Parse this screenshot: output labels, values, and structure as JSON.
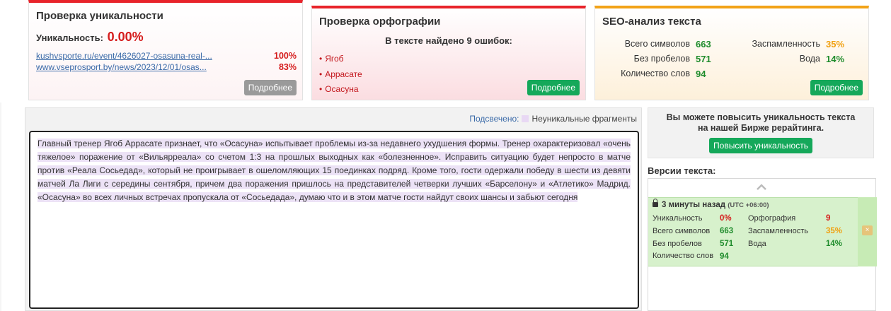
{
  "uniqueness": {
    "title": "Проверка уникальности",
    "label": "Уникальность:",
    "value": "0.00%",
    "sources": [
      {
        "url": "kushvsporte.ru/event/4626027-osasuna-real-...",
        "percent": "100%"
      },
      {
        "url": "www.vseprosport.by/news/2023/12/01/osas...",
        "percent": "83%"
      }
    ],
    "more_label": "Подробнее"
  },
  "spelling": {
    "title": "Проверка орфографии",
    "found_text": "В тексте найдено 9 ошибок:",
    "errors": [
      "Ягоб",
      "Аррасате",
      "Осасуна"
    ],
    "more_label": "Подробнее"
  },
  "seo": {
    "title": "SEO-анализ текста",
    "total_chars_label": "Всего символов",
    "total_chars": "663",
    "no_spaces_label": "Без пробелов",
    "no_spaces": "571",
    "word_count_label": "Количество слов",
    "word_count": "94",
    "spam_label": "Заспамленность",
    "spam": "35%",
    "water_label": "Вода",
    "water": "14%",
    "more_label": "Подробнее"
  },
  "editor": {
    "highlight_label": "Подсвечено:",
    "highlight_desc": "Неуникальные фрагменты",
    "text": "Главный тренер Ягоб Аррасате признает, что «Осасуна» испытывает проблемы из-за недавнего ухудшения формы. Тренер охарактеризовал «очень тяжелое» поражение от «Вильярреала» со счетом 1:3 на прошлых выходных как «болезненное». Исправить ситуацию будет непросто в матче против «Реала Сосьедад», который не проигрывает в ошеломляющих 15 поединках подряд. Кроме того, гости одержали победу в шести из девяти матчей Ла Лиги с середины сентября, причем два поражения пришлось на представителей четверки лучших «Барселону» и «Атлетико» Мадрид. «Осасуна» во всех личных встречах пропускала от «Сосьедада», думаю что и в этом матче гости найдут своих шансы и забьют сегодня"
  },
  "promo": {
    "text": "Вы можете повысить уникальность текста на нашей Бирже рерайтинга.",
    "button": "Повысить уникальность"
  },
  "versions": {
    "title": "Версии текста:",
    "item": {
      "time": "3 минуты назад",
      "tz": "(UTC +06:00)",
      "uniq_label": "Уникальность",
      "uniq": "0%",
      "spell_label": "Орфография",
      "spell": "9",
      "chars_label": "Всего символов",
      "chars": "663",
      "spam_label": "Заспамленность",
      "spam": "35%",
      "nospace_label": "Без пробелов",
      "nospace": "571",
      "water_label": "Вода",
      "water": "14%",
      "words_label": "Количество слов",
      "words": "94",
      "delete_icon": "×"
    }
  },
  "colors": {
    "red": "#e8232a",
    "orange": "#f2a317",
    "green_button": "#15a85a",
    "highlight": "#e8d8f4"
  }
}
